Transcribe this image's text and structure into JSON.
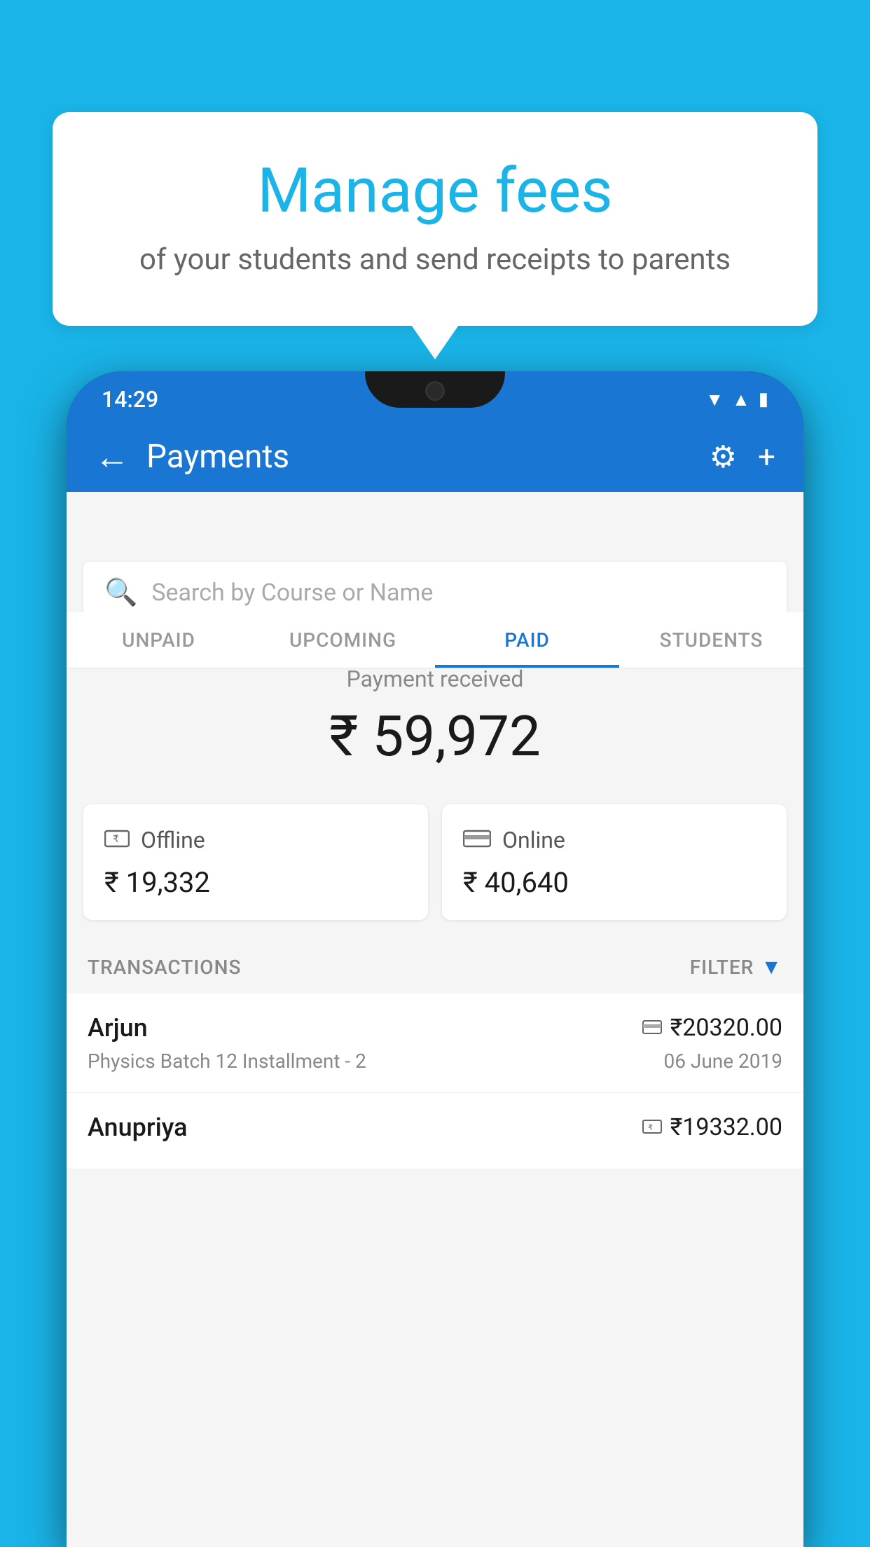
{
  "background": {
    "color": "#1ab4e8"
  },
  "speech_bubble": {
    "title": "Manage fees",
    "subtitle": "of your students and send receipts to parents"
  },
  "phone": {
    "status_bar": {
      "time": "14:29",
      "wifi_icon": "▲",
      "signal_icon": "▲",
      "battery_icon": "▮"
    },
    "header": {
      "back_label": "←",
      "title": "Payments",
      "settings_icon": "⚙",
      "add_icon": "+"
    },
    "tabs": [
      {
        "label": "UNPAID",
        "active": false
      },
      {
        "label": "UPCOMING",
        "active": false
      },
      {
        "label": "PAID",
        "active": true
      },
      {
        "label": "STUDENTS",
        "active": false
      }
    ],
    "search": {
      "placeholder": "Search by Course or Name"
    },
    "payment_summary": {
      "label": "Payment received",
      "amount": "₹ 59,972"
    },
    "payment_cards": [
      {
        "type": "Offline",
        "amount": "₹ 19,332",
        "icon": "💳"
      },
      {
        "type": "Online",
        "amount": "₹ 40,640",
        "icon": "💳"
      }
    ],
    "transactions_section": {
      "label": "TRANSACTIONS",
      "filter_label": "FILTER"
    },
    "transactions": [
      {
        "name": "Arjun",
        "course": "Physics Batch 12 Installment - 2",
        "amount": "₹20320.00",
        "date": "06 June 2019",
        "payment_type": "online"
      },
      {
        "name": "Anupriya",
        "course": "",
        "amount": "₹19332.00",
        "date": "",
        "payment_type": "offline"
      }
    ]
  }
}
